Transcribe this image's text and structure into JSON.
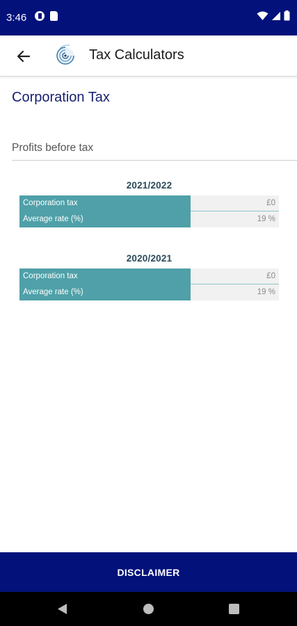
{
  "status_bar": {
    "time": "3:46"
  },
  "app_bar": {
    "title": "Tax Calculators"
  },
  "page": {
    "title": "Corporation Tax"
  },
  "input": {
    "placeholder": "Profits before tax",
    "value": ""
  },
  "results": [
    {
      "year": "2021/2022",
      "rows": [
        {
          "label": "Corporation tax",
          "value": "£0"
        },
        {
          "label": "Average rate (%)",
          "value": "19 %"
        }
      ]
    },
    {
      "year": "2020/2021",
      "rows": [
        {
          "label": "Corporation tax",
          "value": "£0"
        },
        {
          "label": "Average rate (%)",
          "value": "19 %"
        }
      ]
    }
  ],
  "footer": {
    "disclaimer_label": "DISCLAIMER"
  },
  "colors": {
    "primary": "#02127a",
    "teal": "#4fa0a8",
    "title": "#1a2070"
  }
}
